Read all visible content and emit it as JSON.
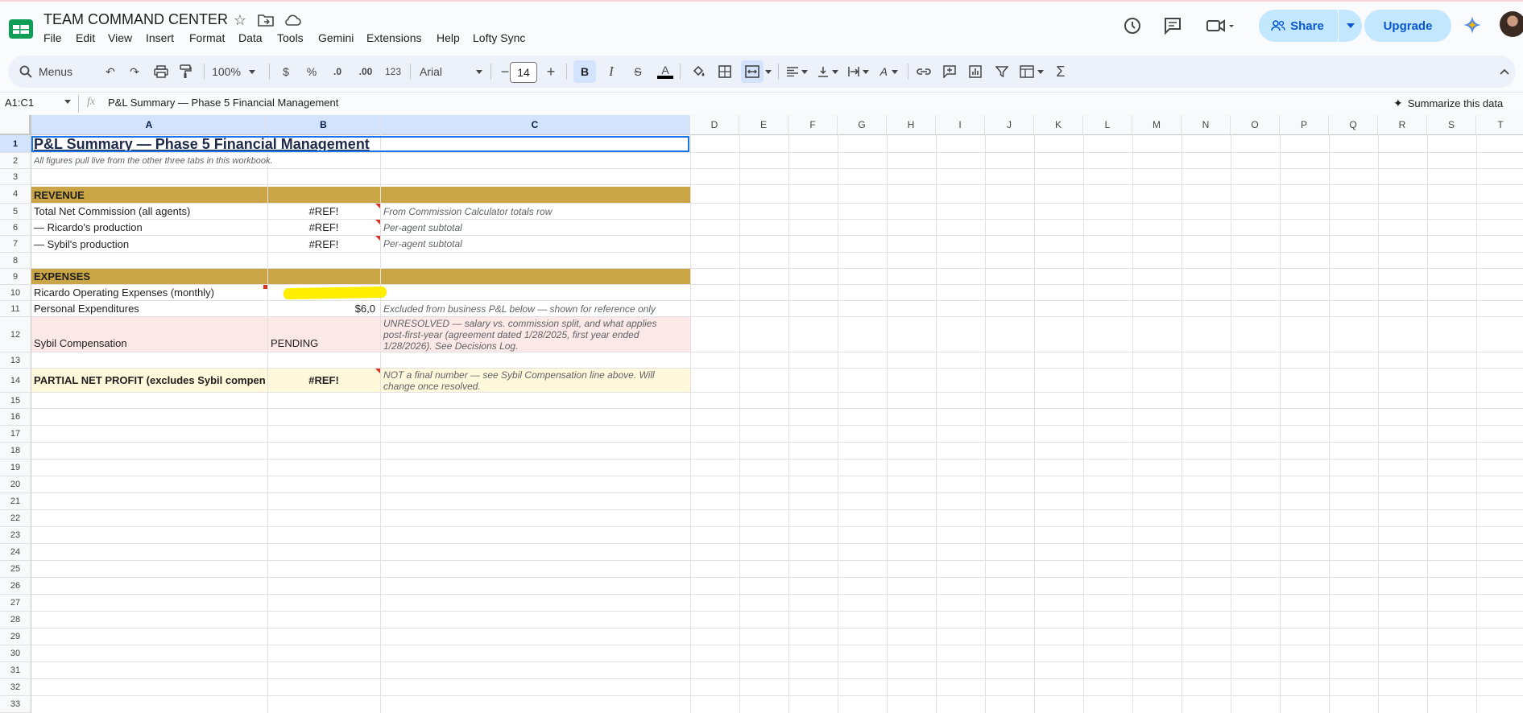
{
  "app": {
    "title": "TEAM COMMAND CENTER",
    "menu": [
      "File",
      "Edit",
      "View",
      "Insert",
      "Format",
      "Data",
      "Tools",
      "Gemini",
      "Extensions",
      "Help",
      "Lofty Sync"
    ],
    "share_label": "Share",
    "upgrade_label": "Upgrade"
  },
  "toolbar": {
    "search_label": "Menus",
    "zoom": "100%",
    "currency": "$",
    "percent": "%",
    "decrease_decimal": ".0",
    "increase_decimal": ".00",
    "number_format": "123",
    "font_family": "Arial",
    "font_size": "14"
  },
  "formula_bar": {
    "name_box": "A1:C1",
    "fx": "fx",
    "content": "P&L Summary — Phase 5 Financial Management",
    "summarize_label": "Summarize this data"
  },
  "columns": [
    "A",
    "B",
    "C",
    "D",
    "E",
    "F",
    "G",
    "H",
    "I",
    "J",
    "K",
    "L",
    "M",
    "N",
    "O",
    "P",
    "Q",
    "R",
    "S",
    "T"
  ],
  "rows": [
    "1",
    "2",
    "3",
    "4",
    "5",
    "6",
    "7",
    "8",
    "9",
    "10",
    "11",
    "12",
    "13",
    "14",
    "15",
    "16",
    "17",
    "18",
    "19",
    "20",
    "21",
    "22",
    "23",
    "24",
    "25",
    "26",
    "27",
    "28",
    "29",
    "30",
    "31",
    "32",
    "33"
  ],
  "sheet": {
    "a1": "P&L Summary — Phase 5 Financial Management",
    "a2": "All figures pull live from the other three tabs in this workbook.",
    "a4": "REVENUE",
    "a5": "Total Net Commission (all agents)",
    "b5": "#REF!",
    "c5": "From Commission Calculator totals row",
    "a6": "— Ricardo's production",
    "b6": "#REF!",
    "c6": "Per-agent subtotal",
    "a7": "— Sybil's production",
    "b7": "#REF!",
    "c7": "Per-agent subtotal",
    "a9": "EXPENSES",
    "a10": "Ricardo Operating Expenses (monthly)",
    "a11": "Personal Expenditures",
    "b11": "$6,0",
    "c11": "Excluded from business P&L below — shown for reference only",
    "a12": "Sybil Compensation",
    "b12": "PENDING",
    "c12": "UNRESOLVED — salary vs. commission split, and what applies post-first-year (agreement dated 1/28/2025, first year ended 1/28/2026). See Decisions Log.",
    "a14": "PARTIAL NET PROFIT (excludes Sybil compen",
    "b14": "#REF!",
    "c14": "NOT a final number — see Sybil Compensation line above. Will change once resolved."
  },
  "colors": {
    "band_gold": "#c9a545",
    "pink": "#fce8e6",
    "cream": "#fff8db",
    "highlight_yellow": "#ffee00",
    "accent_blue": "#0b57d0"
  }
}
